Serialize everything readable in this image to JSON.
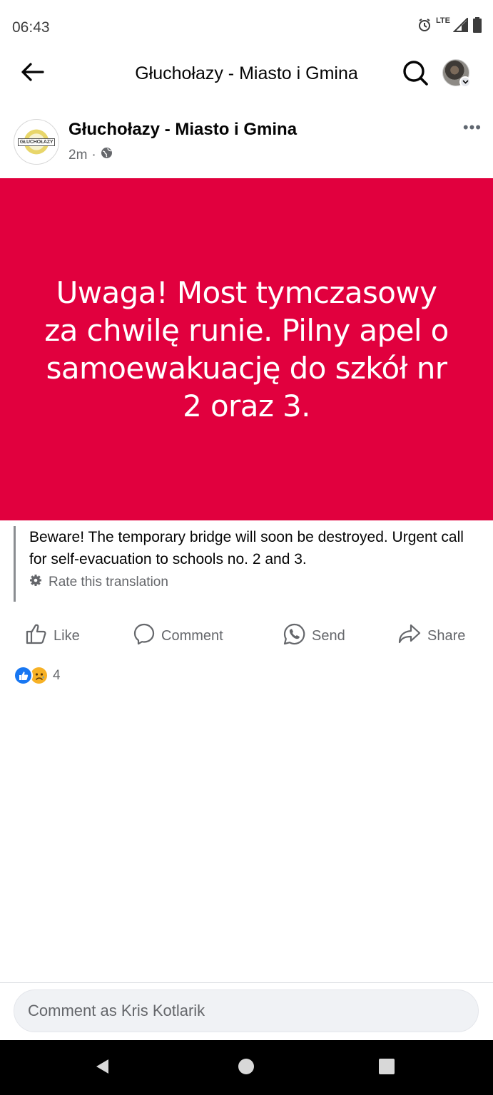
{
  "status_bar": {
    "time": "06:43",
    "network": "LTE",
    "icons": [
      "alarm-icon",
      "signal-icon",
      "battery-icon"
    ]
  },
  "header": {
    "title": "Głuchołazy - Miasto i Gmina",
    "back_icon": "arrow-left-icon",
    "search_icon": "search-icon"
  },
  "post": {
    "page_name": "Głuchołazy - Miasto i Gmina",
    "time": "2m",
    "separator": "·",
    "audience_icon": "globe-icon",
    "more_label": "•••",
    "logo_text": "GŁUCHOŁAZY",
    "banner_text": "Uwaga! Most tymczasowy za chwilę runie. Pilny apel o samoewakuację do szkół nr 2 oraz 3.",
    "banner_color": "#e1003e",
    "translation": "Beware! The temporary bridge will soon be destroyed. Urgent call for self-evacuation to schools no. 2 and 3.",
    "rate_translation": "Rate this translation"
  },
  "actions": {
    "like": "Like",
    "comment": "Comment",
    "send": "Send",
    "share": "Share"
  },
  "reactions": {
    "count": "4",
    "types": [
      "like",
      "sad"
    ]
  },
  "comment_box": {
    "placeholder": "Comment as Kris Kotlarik"
  },
  "colors": {
    "accent": "#1877f2",
    "secondary_text": "#65676b"
  }
}
